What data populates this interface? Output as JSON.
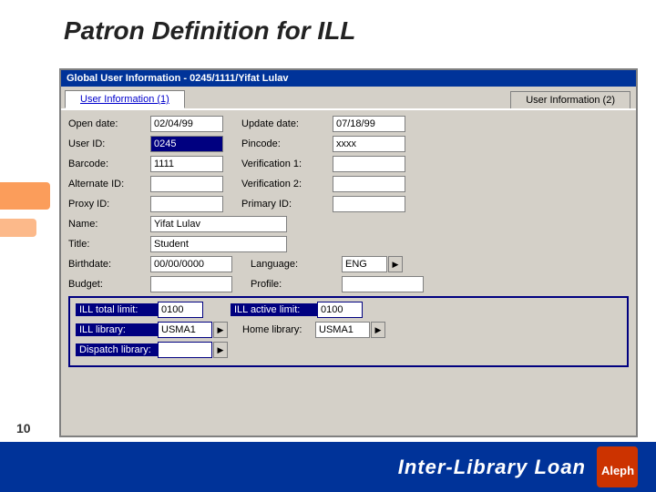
{
  "page": {
    "title": "Patron Definition for ILL",
    "slide_number": "10"
  },
  "window": {
    "titlebar": "Global User Information - 0245/1111/Yifat Lulav",
    "tab1_label": "User Information (1)",
    "tab2_label": "User Information (2)"
  },
  "fields": {
    "open_date_label": "Open date:",
    "open_date_value": "02/04/99",
    "update_date_label": "Update date:",
    "update_date_value": "07/18/99",
    "user_id_label": "User ID:",
    "user_id_value": "0245",
    "pincode_label": "Pincode:",
    "pincode_value": "xxxx",
    "barcode_label": "Barcode:",
    "barcode_value": "1111",
    "verification1_label": "Verification 1:",
    "verification1_value": "",
    "alternate_id_label": "Alternate ID:",
    "alternate_id_value": "",
    "verification2_label": "Verification 2:",
    "verification2_value": "",
    "proxy_id_label": "Proxy ID:",
    "proxy_id_value": "",
    "primary_id_label": "Primary ID:",
    "primary_id_value": "",
    "name_label": "Name:",
    "name_value": "Yifat Lulav",
    "title_label": "Title:",
    "title_value": "Student",
    "birthdate_label": "Birthdate:",
    "birthdate_value": "00/00/0000",
    "language_label": "Language:",
    "language_value": "ENG",
    "budget_label": "Budget:",
    "budget_value": "",
    "profile_label": "Profile:",
    "profile_value": "",
    "ill_total_limit_label": "ILL total limit:",
    "ill_total_limit_value": "0100",
    "ill_active_limit_label": "ILL active limit:",
    "ill_active_limit_value": "0100",
    "ill_library_label": "ILL library:",
    "ill_library_value": "USMA1",
    "home_library_label": "Home library:",
    "home_library_value": "USMA1",
    "dispatch_library_label": "Dispatch library:",
    "dispatch_library_value": ""
  },
  "bottom": {
    "label": "Inter-Library Loan",
    "logo_text": "Aleph"
  }
}
